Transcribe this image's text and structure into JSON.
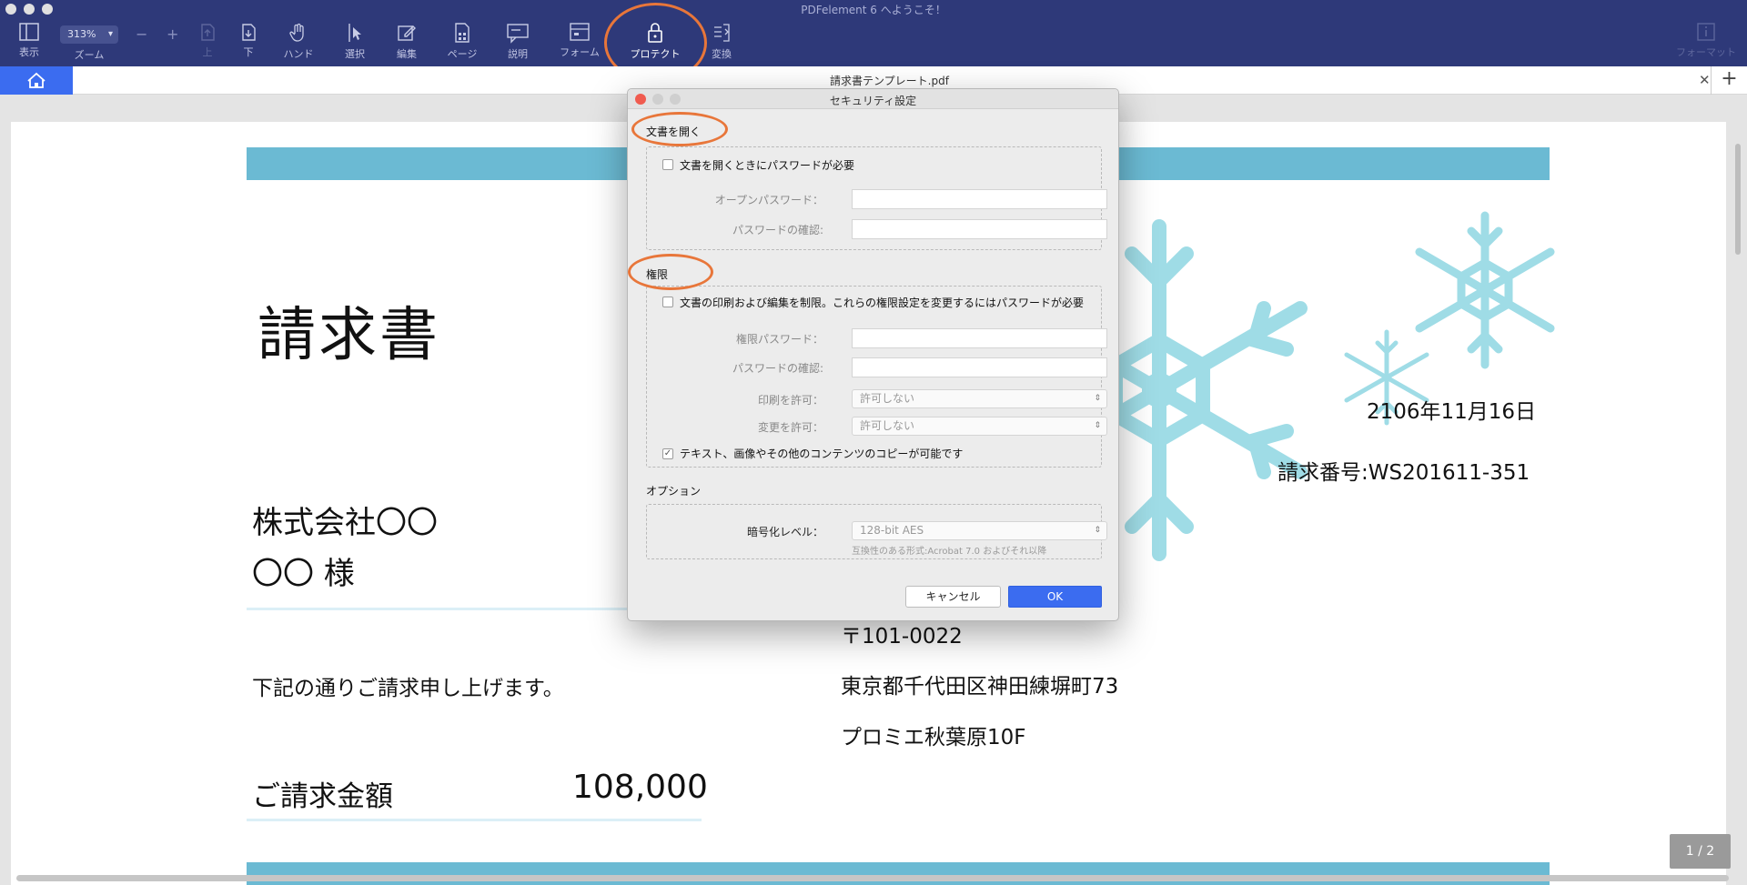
{
  "window": {
    "title": "PDFelement 6 へようこそ！"
  },
  "toolbar": {
    "view": "表示",
    "zoom_label": "ズーム",
    "zoom_value": "313%",
    "zoom_out": "−",
    "zoom_in": "+",
    "up": "上",
    "down": "下",
    "hand": "ハンド",
    "select": "選択",
    "edit": "編集",
    "page": "ページ",
    "comment": "説明",
    "form": "フォーム",
    "protect": "プロテクト",
    "convert": "変換",
    "format": "フォーマット"
  },
  "tab": {
    "title": "請求書テンプレート.pdf"
  },
  "document": {
    "title": "請求書",
    "date": "2106年11月16日",
    "invoice_number": "請求番号:WS201611-351",
    "company": "株式会社〇〇",
    "recipient": "〇〇 様",
    "intro": "下記の通りご請求申し上げます。",
    "amount_label": "ご請求金額",
    "amount": "108,000",
    "postal": "〒101-0022",
    "address": "東京都千代田区神田練塀町73",
    "building": "プロミエ秋葉原10F",
    "page_indicator": "1 / 2"
  },
  "dialog": {
    "title": "セキュリティ設定",
    "open_section": "文書を開く",
    "require_open_password": "文書を開くときにパスワードが必要",
    "open_password_label": "オープンパスワード：",
    "confirm_password_label": "パスワードの確認:",
    "permissions_section": "権限",
    "restrict_label": "文書の印刷および編集を制限。これらの権限設定を変更するにはパスワードが必要",
    "permission_password_label": "権限パスワード：",
    "permission_confirm_label": "パスワードの確認:",
    "print_allowed_label": "印刷を許可：",
    "print_allowed_value": "許可しない",
    "change_allowed_label": "変更を許可：",
    "change_allowed_value": "許可しない",
    "copy_label": "テキスト、画像やその他のコンテンツのコピーが可能です",
    "options_section": "オプション",
    "encryption_label": "暗号化レベル：",
    "encryption_value": "128-bit AES",
    "compatibility": "互換性のある形式:Acrobat 7.0 およびそれ以降",
    "cancel": "キャンセル",
    "ok": "OK"
  },
  "colors": {
    "toolbar": "#2e3979",
    "accent_blue": "#3b6cf0",
    "band": "#6bbad3",
    "snowflake": "#9fdce6",
    "highlight": "#e8763a"
  }
}
